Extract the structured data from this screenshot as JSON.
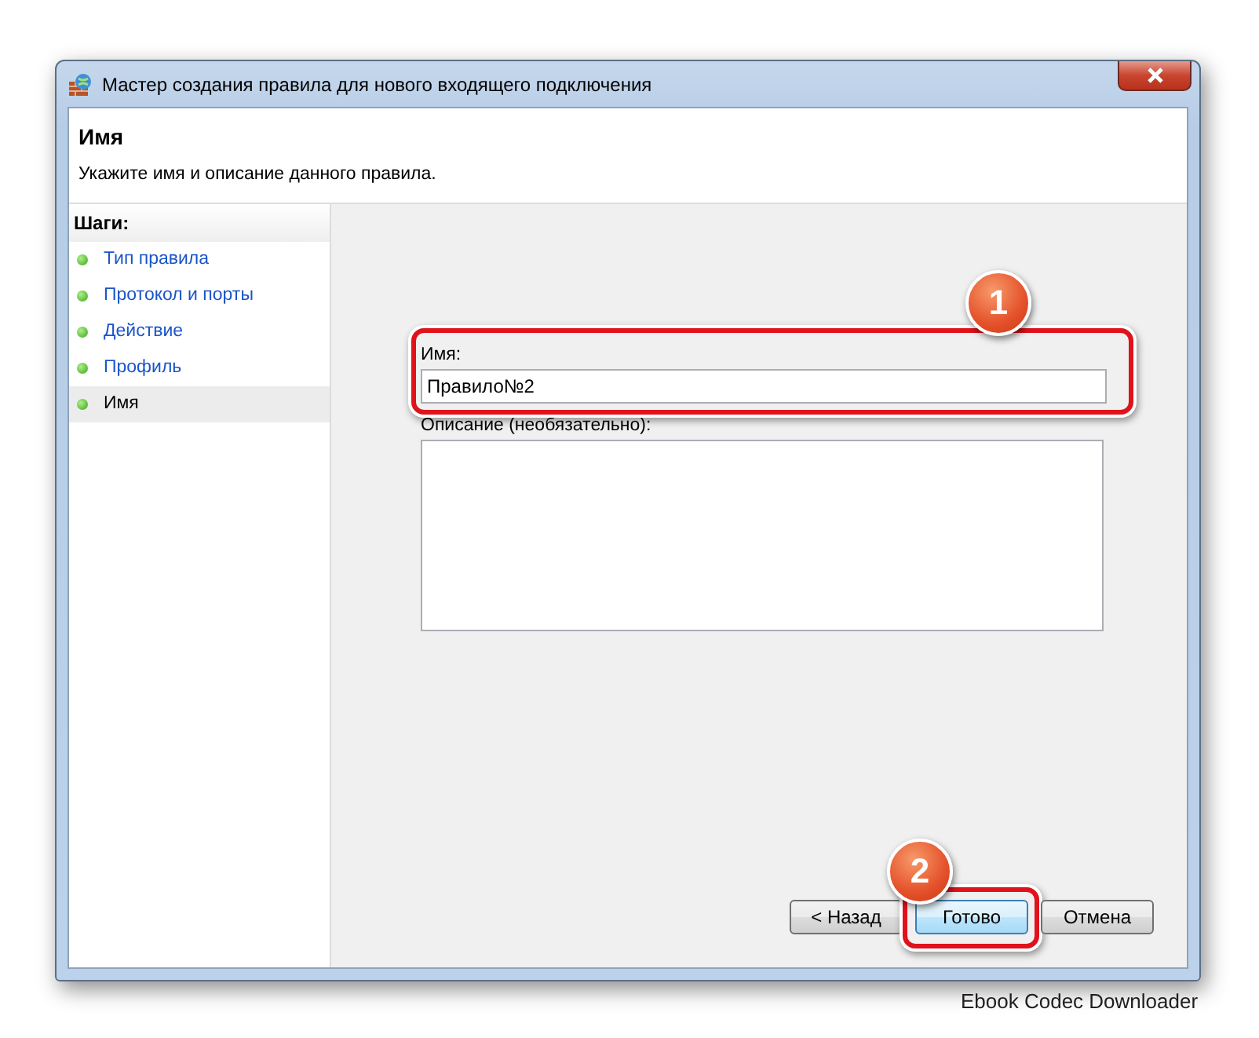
{
  "window": {
    "title": "Мастер создания правила для нового входящего подключения"
  },
  "header": {
    "title": "Имя",
    "subtitle": "Укажите имя и описание данного правила."
  },
  "steps": {
    "title": "Шаги:",
    "items": [
      {
        "label": "Тип правила",
        "selected": false
      },
      {
        "label": "Протокол и порты",
        "selected": false
      },
      {
        "label": "Действие",
        "selected": false
      },
      {
        "label": "Профиль",
        "selected": false
      },
      {
        "label": "Имя",
        "selected": true
      }
    ]
  },
  "form": {
    "name_label": "Имя:",
    "name_value": "Правило№2",
    "description_label": "Описание (необязательно):"
  },
  "buttons": [
    {
      "label": "< Назад",
      "default": false
    },
    {
      "label": "Готово",
      "default": true
    },
    {
      "label": "Отмена",
      "default": false
    }
  ],
  "annotations": [
    {
      "number": "1"
    },
    {
      "number": "2"
    }
  ],
  "background_text": "Ebook Codec Downloader"
}
